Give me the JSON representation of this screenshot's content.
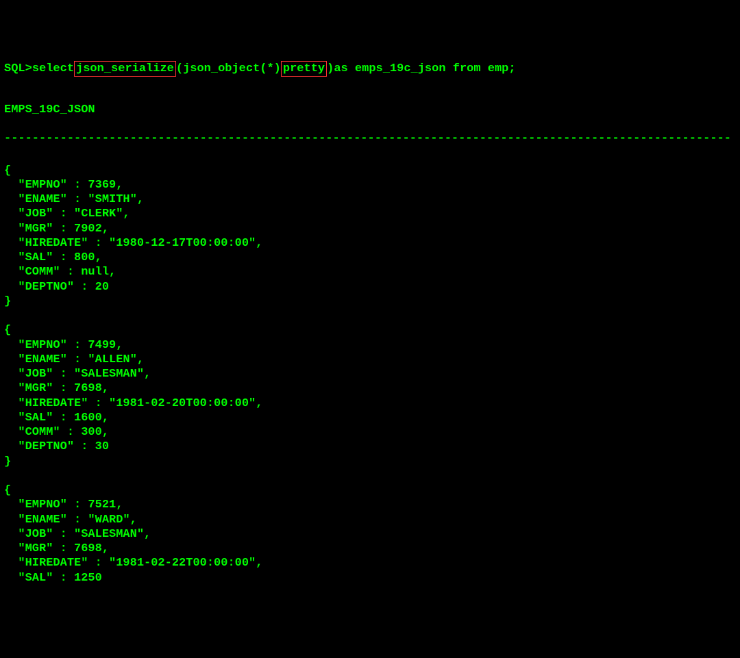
{
  "prompt": {
    "prefix": "SQL> ",
    "kw_select": "select ",
    "fn_serialize": "json_serialize",
    "open_paren": "(",
    "fn_object": "json_object(*) ",
    "kw_pretty": "pretty",
    "close_paren": ") ",
    "alias": "as emps_19c_json from emp;"
  },
  "column_header": "EMPS_19C_JSON",
  "records": [
    {
      "EMPNO": 7369,
      "ENAME": "SMITH",
      "JOB": "CLERK",
      "MGR": 7902,
      "HIREDATE": "1980-12-17T00:00:00",
      "SAL": 800,
      "COMM": null,
      "DEPTNO": 20
    },
    {
      "EMPNO": 7499,
      "ENAME": "ALLEN",
      "JOB": "SALESMAN",
      "MGR": 7698,
      "HIREDATE": "1981-02-20T00:00:00",
      "SAL": 1600,
      "COMM": 300,
      "DEPTNO": 30
    },
    {
      "EMPNO": 7521,
      "ENAME": "WARD",
      "JOB": "SALESMAN",
      "MGR": 7698,
      "HIREDATE": "1981-02-22T00:00:00",
      "SAL": 1250
    }
  ],
  "partial_last_record": true
}
